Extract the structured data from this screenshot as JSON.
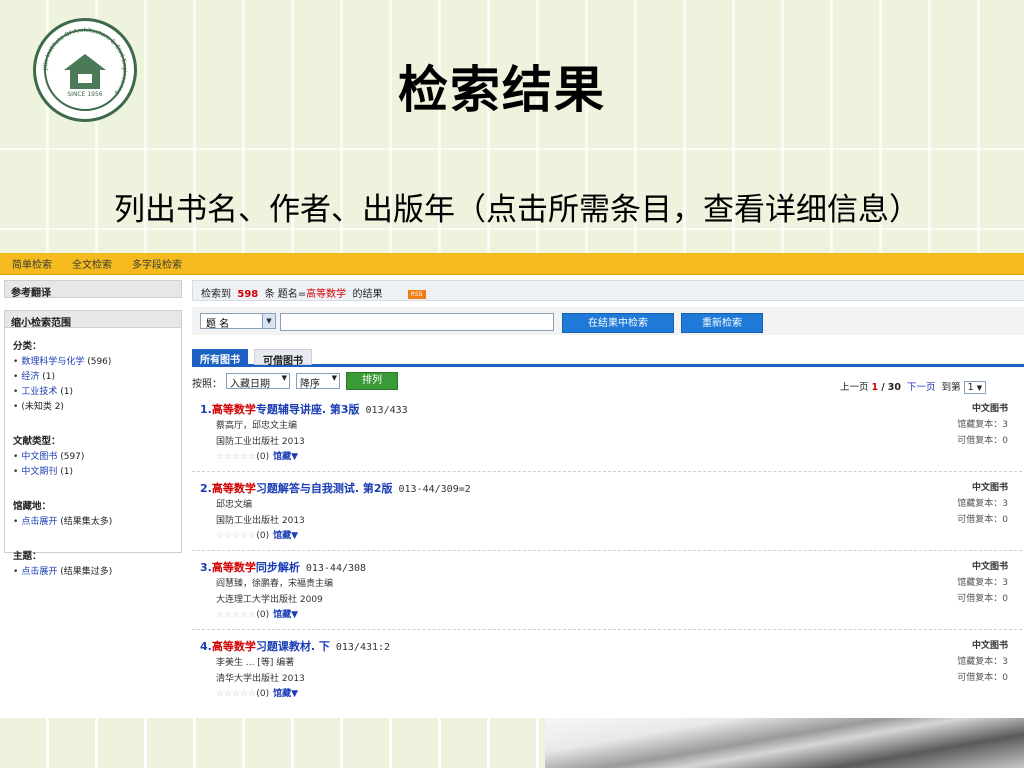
{
  "slide": {
    "title": "检索结果",
    "subtitle": "列出书名、作者、出版年（点击所需条目，查看详细信息）"
  },
  "logo": {
    "since": "SINCE 1956"
  },
  "top_tabs": [
    "简单检索",
    "全文检索",
    "多字段检索"
  ],
  "sidebar": {
    "ref_header": "参考翻译",
    "narrow_header": "缩小检索范围",
    "groups": [
      {
        "title": "分类：",
        "items": [
          {
            "label": "数理科学与化学",
            "count": "(596)",
            "link": true
          },
          {
            "label": "经济",
            "count": "(1)",
            "link": true
          },
          {
            "label": "工业技术",
            "count": "(1)",
            "link": true
          },
          {
            "label": "(未知类",
            "count": "2)",
            "link": false
          }
        ]
      },
      {
        "title": "文献类型：",
        "items": [
          {
            "label": "中文图书",
            "count": "(597)",
            "link": true
          },
          {
            "label": "中文期刊",
            "count": "(1)",
            "link": true
          }
        ]
      },
      {
        "title": "馆藏地：",
        "items": [
          {
            "label": "点击展开",
            "count": "(结果集太多)",
            "link": true
          }
        ]
      },
      {
        "title": "主题：",
        "items": [
          {
            "label": "点击展开",
            "count": "(结果集过多)",
            "link": true
          }
        ]
      }
    ]
  },
  "result_bar": {
    "prefix": "检索到",
    "count": "598",
    "mid": "条  题名=",
    "query": "高等数学",
    "suffix": "的结果",
    "rss": "RSS"
  },
  "search": {
    "field": "题  名",
    "value": "",
    "btn_within": "在结果中检索",
    "btn_new": "重新检索"
  },
  "book_tabs": {
    "all": "所有图书",
    "available": "可借图书"
  },
  "sort": {
    "label": "按照：",
    "by": "入藏日期",
    "order": "降序",
    "btn": "排列"
  },
  "pager": {
    "prev": "上一页",
    "current": "1",
    "sep": "/",
    "total": "30",
    "next": "下一页",
    "goto": "到第",
    "page": "1"
  },
  "records": [
    {
      "num": "1.",
      "hl": "高等数学",
      "rest": "专题辅导讲座. 第3版",
      "call": "013/433",
      "author": "蔡高厅，邱忠文主编",
      "pub": "国防工业出版社 2013",
      "stars": "☆☆☆☆☆",
      "rating": "(0)",
      "collect": "馆藏▼",
      "type": "中文图书",
      "copies": "馆藏复本：3",
      "avail": "可借复本：0"
    },
    {
      "num": "2.",
      "hl": "高等数学",
      "rest": "习题解答与自我测试. 第2版",
      "call": "013-44/309=2",
      "author": "邱忠文编",
      "pub": "国防工业出版社 2013",
      "stars": "☆☆☆☆☆",
      "rating": "(0)",
      "collect": "馆藏▼",
      "type": "中文图书",
      "copies": "馆藏复本：3",
      "avail": "可借复本：0"
    },
    {
      "num": "3.",
      "hl": "高等数学",
      "rest": "同步解析",
      "call": "013-44/308",
      "author": "阎慧臻，徐鹏春，宋福贵主编",
      "pub": "大连理工大学出版社 2009",
      "stars": "☆☆☆☆☆",
      "rating": "(0)",
      "collect": "馆藏▼",
      "type": "中文图书",
      "copies": "馆藏复本：3",
      "avail": "可借复本：0"
    },
    {
      "num": "4.",
      "hl": "高等数学",
      "rest": "习题课教材. 下",
      "call": "013/431:2",
      "author": "李美生 ... [等] 编著",
      "pub": "清华大学出版社 2013",
      "stars": "☆☆☆☆☆",
      "rating": "(0)",
      "collect": "馆藏▼",
      "type": "中文图书",
      "copies": "馆藏复本：3",
      "avail": "可借复本：0"
    }
  ]
}
